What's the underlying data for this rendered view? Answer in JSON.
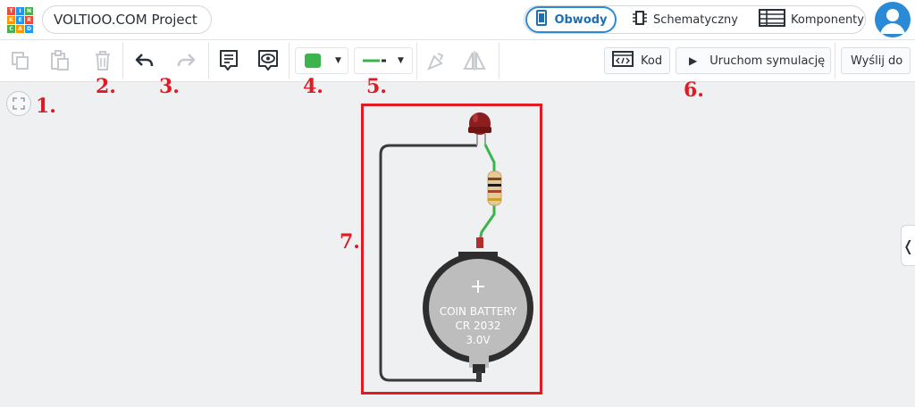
{
  "logo": {
    "letters": [
      "T",
      "I",
      "N",
      "K",
      "E",
      "R",
      "C",
      "A",
      "D"
    ],
    "colors": [
      "#e74c3c",
      "#2196f3",
      "#4caf50",
      "#ff9800",
      "#2196f3",
      "#e74c3c",
      "#4caf50",
      "#ff9800",
      "#2196f3"
    ]
  },
  "project_title": "VOLTIOO.COM Project",
  "view_tabs": [
    {
      "label": "Obwody",
      "icon": "circuit-icon",
      "active": true
    },
    {
      "label": "Schematyczny",
      "icon": "schematic-icon",
      "active": false
    },
    {
      "label": "Komponenty",
      "icon": "components-list-icon",
      "active": false
    }
  ],
  "toolbar": {
    "code_label": "Kod",
    "simulate_label": "Uruchom symulację",
    "send_label": "Wyślij do",
    "fill_color": "#3cb44b",
    "wire_color": "#3cb44b"
  },
  "annotations": [
    "1.",
    "2.",
    "3.",
    "4.",
    "5.",
    "6.",
    "7."
  ],
  "circuit": {
    "battery_lines": [
      "COIN BATTERY",
      "CR 2032",
      "3.0V"
    ],
    "battery_plus": "+"
  },
  "colors": {
    "accent": "#2b8ad6",
    "annotation": "#e01b24",
    "wire": "#3cb44b",
    "wire_black": "#3a3a3a"
  }
}
